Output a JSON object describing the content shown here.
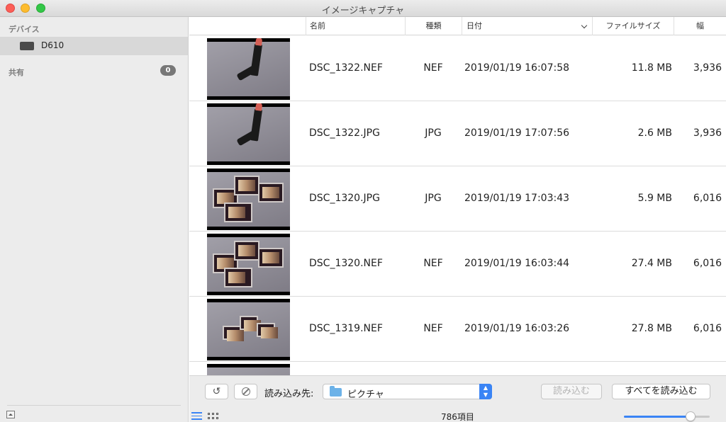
{
  "window": {
    "title": "イメージキャプチャ"
  },
  "sidebar": {
    "devices_heading": "デバイス",
    "device": {
      "name": "D610",
      "icon": "camera-icon"
    },
    "shared_heading": "共有",
    "shared_count": "0"
  },
  "table": {
    "columns": {
      "name": "名前",
      "type": "種類",
      "date": "日付",
      "size": "ファイルサイズ",
      "width": "幅"
    },
    "rows": [
      {
        "name": "DSC_1322.NEF",
        "type": "NEF",
        "date": "2019/01/19 16:07:58",
        "size": "11.8 MB",
        "width": "3,936",
        "thumb": "lipstick"
      },
      {
        "name": "DSC_1322.JPG",
        "type": "JPG",
        "date": "2019/01/19 17:07:56",
        "size": "2.6 MB",
        "width": "3,936",
        "thumb": "lipstick"
      },
      {
        "name": "DSC_1320.JPG",
        "type": "JPG",
        "date": "2019/01/19 17:03:43",
        "size": "5.9 MB",
        "width": "6,016",
        "thumb": "palettes"
      },
      {
        "name": "DSC_1320.NEF",
        "type": "NEF",
        "date": "2019/01/19 16:03:44",
        "size": "27.4 MB",
        "width": "6,016",
        "thumb": "palettes"
      },
      {
        "name": "DSC_1319.NEF",
        "type": "NEF",
        "date": "2019/01/19 16:03:26",
        "size": "27.8 MB",
        "width": "6,016",
        "thumb": "palettes-small"
      }
    ]
  },
  "toolbar": {
    "import_to_label": "読み込み先:",
    "destination": "ピクチャ",
    "import_button": "読み込む",
    "import_all_button": "すべてを読み込む",
    "item_count": "786項目",
    "thumbnail_size_level": 0.78
  },
  "colors": {
    "accent": "#3a84f5",
    "sidebar_bg": "#ececec",
    "lipstick": "#d55f55"
  }
}
